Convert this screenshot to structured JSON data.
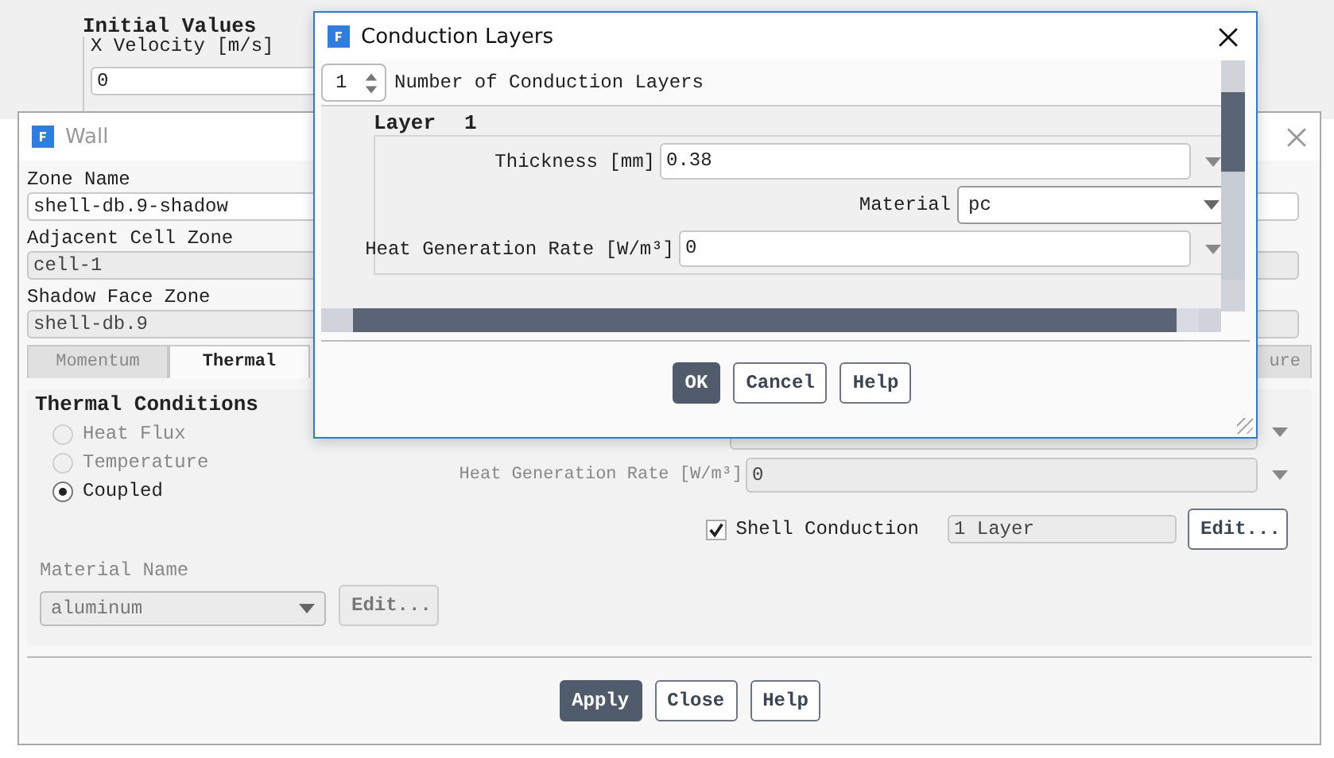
{
  "background_panel": {
    "title": "Initial Values",
    "fields": [
      {
        "label": "X Velocity [m/s]",
        "value": "0"
      }
    ]
  },
  "wall_window": {
    "title": "Wall",
    "active": false,
    "zone_fields": [
      {
        "label": "Zone Name",
        "value": "shell-db.9-shadow",
        "disabled": false
      },
      {
        "label": "Adjacent Cell Zone",
        "value": "cell-1",
        "disabled": true
      },
      {
        "label": "Shadow Face Zone",
        "value": "shell-db.9",
        "disabled": true
      }
    ],
    "tabs": [
      {
        "label": "Momentum",
        "selected": false
      },
      {
        "label": "Thermal",
        "selected": true
      },
      {
        "label": "ure",
        "selected": false
      }
    ],
    "thermal_conditions": {
      "title": "Thermal Conditions",
      "options": [
        {
          "label": "Heat Flux",
          "selected": false,
          "disabled": true
        },
        {
          "label": "Temperature",
          "selected": false,
          "disabled": true
        },
        {
          "label": "Coupled",
          "selected": true,
          "disabled": false
        }
      ]
    },
    "material": {
      "label": "Material Name",
      "value": "aluminum",
      "disabled": true,
      "edit_button": {
        "label": "Edit...",
        "disabled": true
      }
    },
    "heat_generation": {
      "label": "Heat Generation Rate [W/m³]",
      "value": "0",
      "disabled": true
    },
    "shell_conduction": {
      "label": "Shell Conduction",
      "checked": true,
      "layers": "1 Layer",
      "edit_button": {
        "label": "Edit...",
        "disabled": false
      }
    },
    "buttons": [
      {
        "label": "Apply",
        "primary": true
      },
      {
        "label": "Close",
        "primary": false
      },
      {
        "label": "Help",
        "primary": false
      }
    ]
  },
  "dialog": {
    "title": "Conduction Layers",
    "active": true,
    "layer_count": "1",
    "layer_count_label": "Number of Conduction Layers",
    "layers": [
      {
        "title": "Layer",
        "index": "1",
        "thickness_label": "Thickness [mm]",
        "thickness": "0.38",
        "material_label": "Material",
        "material": "pc",
        "heat_label": "Heat Generation Rate [W/m³]",
        "heat": "0"
      }
    ],
    "buttons": [
      {
        "label": "OK",
        "primary": true
      },
      {
        "label": "Cancel",
        "primary": false
      },
      {
        "label": "Help",
        "primary": false
      }
    ]
  }
}
